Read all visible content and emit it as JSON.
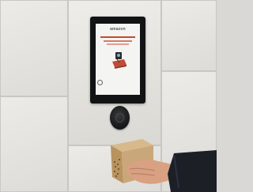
{
  "scene": {
    "description_name": "locker-terminal-scene"
  },
  "screen": {
    "brand": "amazon"
  },
  "colors": {
    "wall": "#e2e1dd",
    "bezel": "#121314",
    "screen_bg": "#f4f4f2",
    "accent": "#c24b33",
    "box": "#c9a77a",
    "sleeve": "#1c1f26",
    "skin": "#d7a182"
  }
}
